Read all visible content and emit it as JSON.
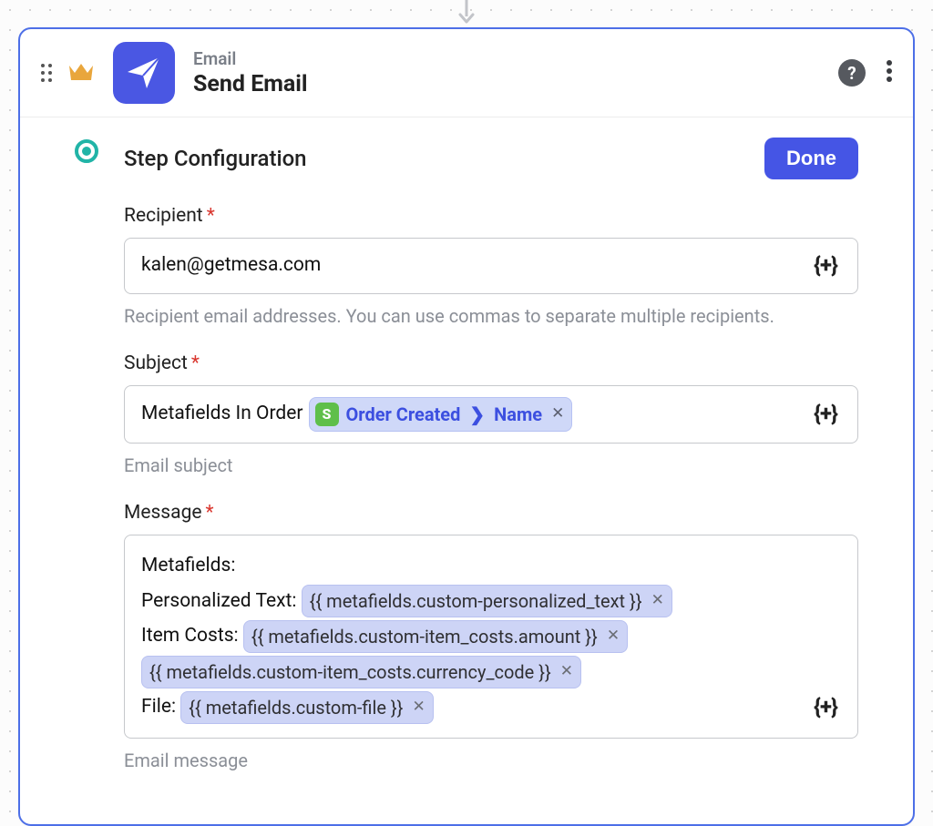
{
  "header": {
    "overline": "Email",
    "title": "Send Email"
  },
  "step": {
    "section_title": "Step Configuration",
    "done_label": "Done"
  },
  "fields": {
    "recipient": {
      "label": "Recipient",
      "value": "kalen@getmesa.com",
      "helper": "Recipient email addresses. You can use commas to separate multiple recipients."
    },
    "subject": {
      "label": "Subject",
      "prefix_text": "Metafields In Order ",
      "token": {
        "source": "Order Created",
        "field": "Name"
      },
      "helper": "Email subject"
    },
    "message": {
      "label": "Message",
      "line1_prefix": "Metafields:",
      "line2_prefix": "Personalized Text: ",
      "line2_token": "{{ metafields.custom-personalized_text }}",
      "line3_prefix": "Item Costs: ",
      "line3_token": "{{ metafields.custom-item_costs.amount }}",
      "line4_token": "{{ metafields.custom-item_costs.currency_code }}",
      "line5_prefix": "File: ",
      "line5_token": "{{ metafields.custom-file }}",
      "helper": "Email message"
    }
  },
  "glyphs": {
    "insert_var": "{+}",
    "remove_x": "✕",
    "required": "*",
    "shopify_s": "S",
    "help_q": "?",
    "chevron": "❯"
  }
}
